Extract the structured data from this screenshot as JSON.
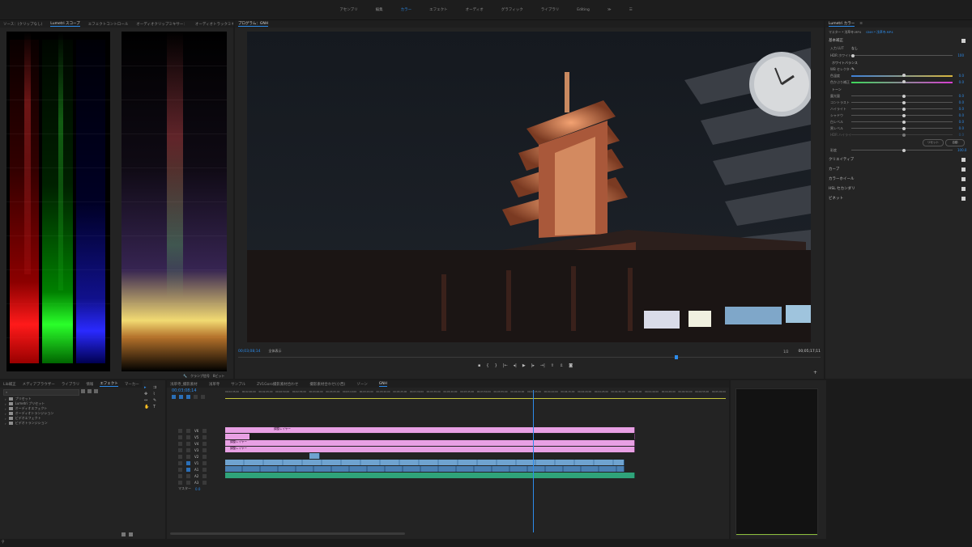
{
  "workspaces": {
    "items": [
      "アセンブリ",
      "編集",
      "カラー",
      "エフェクト",
      "オーディオ",
      "グラフィック",
      "ライブラリ",
      "Editing",
      "≫",
      "☰"
    ],
    "active_index": 2
  },
  "source_panel": {
    "tabs": [
      "ソース：(クリップなし)",
      "Lumetri スコープ",
      "エフェクトコントロール",
      "オーディオクリップミキサー：",
      "オーディオトラックミキサー：GNH"
    ],
    "active_index": 1,
    "bottom_label": "クランプ信号",
    "bottom_mode": "8ビット"
  },
  "program": {
    "title": "プログラム：GNH",
    "timecode": "00;03;08;14",
    "fit_label": "全体表示",
    "resolution": "1/2",
    "duration": "00;05;17;11"
  },
  "lumetri": {
    "header_tabs": [
      "Lumetri カラー",
      "≡"
    ],
    "clip_path": "マスター * 浅草寺.MP4",
    "sequence_path": "GNH * 浅草寺.MP4",
    "sections": {
      "basic": "基本補正",
      "lut_label": "入力 LUT",
      "lut_value": "なし",
      "intensity_label": "HDR ホワイト",
      "wb_header": "ホワイトバランス",
      "wb_selector": "WB セレクター",
      "temp": "色温度",
      "tint": "色かぶり補正",
      "tone_header": "トーン",
      "exposure": "露光量",
      "contrast": "コントラスト",
      "highlights": "ハイライト",
      "shadows": "シャドウ",
      "whites": "白レベル",
      "blacks": "黒レベル",
      "hdr_spec": "HDR ハイライト",
      "reset": "リセット",
      "auto": "自動",
      "saturation": "彩度",
      "creative": "クリエイティブ",
      "curves": "カーブ",
      "wheels": "カラーホイール",
      "hsl": "HSL セカンダリ",
      "vignette": "ビネット"
    },
    "values": {
      "temp": "0.0",
      "tint": "0.0",
      "exposure": "0.0",
      "contrast": "0.0",
      "highlights": "0.0",
      "shadows": "0.0",
      "whites": "0.0",
      "blacks": "0.0",
      "hdr": "0.0",
      "saturation": "100.0",
      "intensity": "100"
    }
  },
  "project": {
    "tabs": [
      "Lib補正",
      "メディアブラウザー",
      "ライブラリ",
      "情報",
      "エフェクト",
      "マーカー",
      "≫"
    ],
    "active_index": 4,
    "items": [
      "プリセット",
      "Lumetri プリセット",
      "オーディオエフェクト",
      "オーディオトランジション",
      "ビデオエフェクト",
      "ビデオトランジション"
    ]
  },
  "timeline": {
    "tabs": [
      "浅草寺_撮影素材",
      "浅草寺",
      "サンプル",
      "ZV1Goro撮影素材合わせ",
      "撮影素材合わせ(小西)",
      "ゾーン",
      "GNH"
    ],
    "active_index": 6,
    "timecode": "00;03;08;14",
    "ruler": [
      "00;02;35;00",
      "00;02;40;00",
      "00;02;45;00",
      "00;02;50;00",
      "00;02;55;00",
      "00;03;00;00",
      "00;03;05;00",
      "00;03;10;00",
      "00;03;15;00",
      "00;03;20;00",
      "00;03;25;00",
      "00;03;30;00",
      "00;03;35;00",
      "00;03;40;00",
      "00;03;45;00",
      "00;03;50;00",
      "00;03;55;00",
      "00;04;00;00",
      "00;04;05;00",
      "00;04;10;00",
      "00;04;15;00",
      "00;04;20;00",
      "00;04;25;00",
      "00;04;30;00",
      "00;04;35;00",
      "00;04;40;00",
      "00;04;45;00",
      "00;04;50;00",
      "00;04;55;00",
      "00;05;00;00"
    ],
    "adjustment_label": "調整レイヤー",
    "tracks": [
      "V6",
      "V5",
      "V4",
      "V3",
      "V2",
      "V1",
      "A1",
      "A2",
      "A3"
    ],
    "master_label": "マスター",
    "master_value": "0.0"
  },
  "colors": {
    "accent": "#2d8ceb",
    "adjust_clip": "#e8a0e4",
    "video_clip": "#6fa3d0",
    "audio_clip": "#2fa37a"
  }
}
